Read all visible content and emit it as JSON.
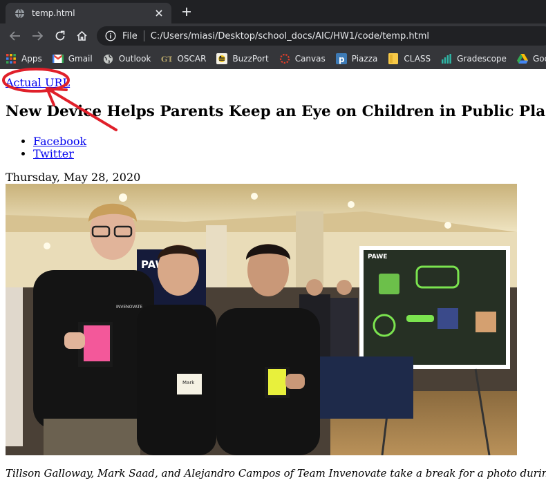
{
  "browser": {
    "tab": {
      "title": "temp.html"
    },
    "address_bar": {
      "scheme_label": "File",
      "url": "C:/Users/miasi/Desktop/school_docs/AIC/HW1/code/temp.html"
    },
    "bookmarks": [
      {
        "label": "Apps",
        "icon": "apps-grid-icon"
      },
      {
        "label": "Gmail",
        "icon": "gmail-icon"
      },
      {
        "label": "Outlook",
        "icon": "globe-icon"
      },
      {
        "label": "OSCAR",
        "icon": "gt-icon"
      },
      {
        "label": "BuzzPort",
        "icon": "buzz-icon"
      },
      {
        "label": "Canvas",
        "icon": "canvas-icon"
      },
      {
        "label": "Piazza",
        "icon": "piazza-icon"
      },
      {
        "label": "CLASS",
        "icon": "folder-icon"
      },
      {
        "label": "Gradescope",
        "icon": "bars-icon"
      },
      {
        "label": "Google",
        "icon": "drive-icon"
      }
    ]
  },
  "page": {
    "actual_url_link": "Actual URL",
    "headline": "New Device Helps Parents Keep an Eye on Children in Public Places",
    "share_links": [
      "Facebook",
      "Twitter"
    ],
    "date": "Thursday, May 28, 2020",
    "photo": {
      "badge_text": "Mark",
      "shirt_text": "INVENOVATE",
      "poster_title": "PAWE",
      "screen_text": "PAWE"
    },
    "caption": "Tillson Galloway, Mark Saad, and Alejandro Campos of Team Invenovate take a break for a photo during a recent qualifyi"
  },
  "colors": {
    "tabstrip": "#202124",
    "toolbar": "#35363a",
    "link": "#0000ee",
    "annotation": "#e0202a"
  }
}
